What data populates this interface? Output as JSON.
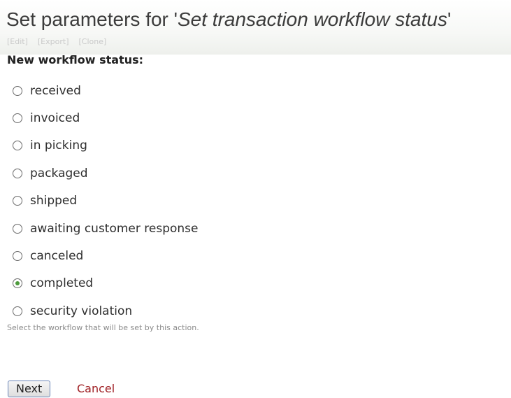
{
  "header": {
    "title_prefix": "Set parameters for '",
    "title_action": "Set transaction workflow status",
    "title_suffix": "'",
    "links": [
      "[Edit]",
      "[Export]",
      "[Clone]"
    ]
  },
  "form": {
    "field_label": "New workflow status:",
    "options": [
      {
        "label": "received",
        "checked": false
      },
      {
        "label": "invoiced",
        "checked": false
      },
      {
        "label": "in picking",
        "checked": false
      },
      {
        "label": "packaged",
        "checked": false
      },
      {
        "label": "shipped",
        "checked": false
      },
      {
        "label": "awaiting customer response",
        "checked": false
      },
      {
        "label": "canceled",
        "checked": false
      },
      {
        "label": "completed",
        "checked": true
      },
      {
        "label": "security violation",
        "checked": false
      }
    ],
    "selected_value": "completed",
    "help_text": "Select the workflow that will be set by this action."
  },
  "buttons": {
    "next_label": "Next",
    "cancel_label": "Cancel"
  },
  "colors": {
    "title": "#3c3c3c",
    "radio_checked_dot": "#4c9a3b",
    "cancel_link": "#a02024",
    "muted_links": "#c9c9c9"
  }
}
